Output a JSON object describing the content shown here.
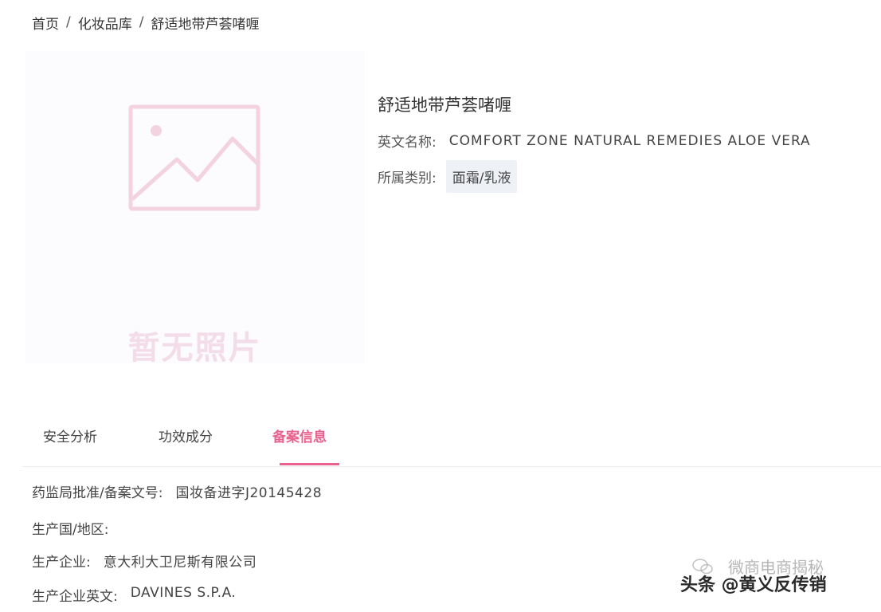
{
  "breadcrumb": {
    "home": "首页",
    "separator": "/",
    "library": "化妆品库",
    "current": "舒适地带芦荟啫喱"
  },
  "image": {
    "placeholder_icon": "image-placeholder-icon",
    "no_photo_text": "暂无照片"
  },
  "product": {
    "name": "舒适地带芦荟啫喱",
    "english_name_label": "英文名称:",
    "english_name": "COMFORT ZONE NATURAL REMEDIES ALOE VERA",
    "category_label": "所属类别:",
    "category": "面霜/乳液"
  },
  "tabs": [
    {
      "label": "安全分析",
      "active": false
    },
    {
      "label": "功效成分",
      "active": false
    },
    {
      "label": "备案信息",
      "active": true
    }
  ],
  "details": [
    {
      "label": "药监局批准/备案文号:",
      "value": "国妆备进字J20145428"
    },
    {
      "label": "生产国/地区:",
      "value": ""
    },
    {
      "label": "生产企业:",
      "value": "意大利大卫尼斯有限公司"
    },
    {
      "label": "生产企业英文:",
      "value": "DAVINES S.P.A."
    }
  ],
  "watermark": {
    "main": "头条 @黄义反传销",
    "faded": "微商电商揭秘"
  },
  "colors": {
    "accent": "#e9628e",
    "placeholder": "#f3dde8",
    "tag_bg": "#eef1f6"
  }
}
